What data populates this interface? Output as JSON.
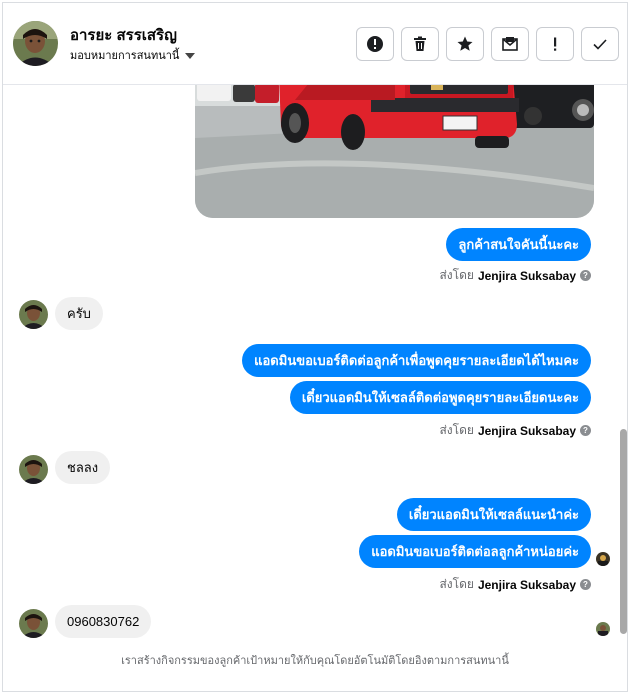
{
  "header": {
    "contact_name": "อารยะ สรรเสริญ",
    "assign_label": "มอบหมายการสนทนานี้",
    "actions": [
      {
        "name": "report-button",
        "icon": "alert-circle-icon"
      },
      {
        "name": "delete-button",
        "icon": "trash-icon"
      },
      {
        "name": "star-button",
        "icon": "star-icon"
      },
      {
        "name": "mark-unread-button",
        "icon": "envelope-icon"
      },
      {
        "name": "spam-button",
        "icon": "exclamation-icon"
      },
      {
        "name": "done-button",
        "icon": "checkmark-icon"
      }
    ]
  },
  "messages": [
    {
      "from": "page",
      "text": "ลูกค้าสนใจคันนี้นะคะ"
    },
    {
      "from": "page",
      "type": "sent_by",
      "prefix": "ส่งโดย",
      "agent": "Jenjira Suksabay"
    },
    {
      "from": "customer",
      "text": "ครับ"
    },
    {
      "from": "page",
      "text": "แอดมินขอเบอร์ติดต่อลูกค้าเพื่อพูดคุยรายละเอียดได้ไหมคะ"
    },
    {
      "from": "page",
      "text": "เดี๋ยวแอดมินให้เซลล์ติดต่อพูดคุยรายละเอียดนะคะ"
    },
    {
      "from": "page",
      "type": "sent_by",
      "prefix": "ส่งโดย",
      "agent": "Jenjira Suksabay"
    },
    {
      "from": "customer",
      "text": "ชลลง"
    },
    {
      "from": "page",
      "text": "เดี๋ยวแอดมินให้เซลล์แนะนำค่ะ"
    },
    {
      "from": "page",
      "text": "แอดมินขอเบอร์ติดต่อลลูกค้าหน่อยค่ะ"
    },
    {
      "from": "page",
      "type": "sent_by",
      "prefix": "ส่งโดย",
      "agent": "Jenjira Suksabay"
    },
    {
      "from": "customer",
      "text": "0960830762"
    }
  ],
  "footer_note": "เราสร้างกิจกรรมของลูกค้าเป้าหมายให้กับคุณโดยอัตโนมัติโดยอิงตามการสนทนานี้",
  "colors": {
    "outgoing_bubble": "#0084ff",
    "incoming_bubble": "#f0f0f0",
    "car_body": "#e0222b"
  }
}
